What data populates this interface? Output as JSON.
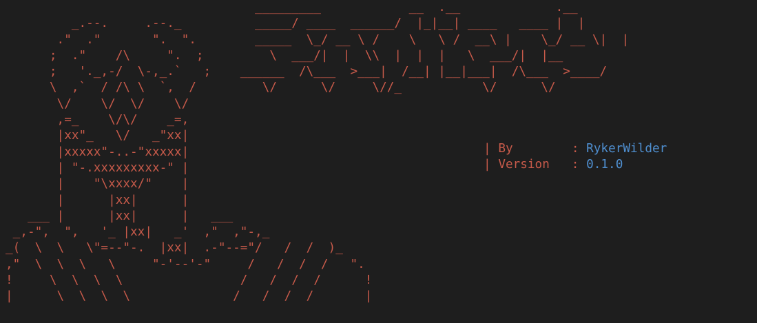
{
  "banner": {
    "art_lines": [
      "                                  _________            __  .__             .__",
      "         _.--.     .--._          _____/ ____  ______/  |_|__| ____   ____ |  |",
      "       .\"  .\"       \".  \".        _____  \\_/ __ \\ /    \\   \\ /  __\\ |    \\_/ __ \\|  |",
      "      ;  .\"    /\\     \".  ;         \\  ___/|  |  \\\\  |  |  |   \\  ___/|  |__",
      "      ;   '._,-/  \\-,_.`   ;    ______  /\\___  >___|  /__| |__|___|  /\\___  >____/",
      "      \\  ,`  / /\\ \\  `,  /         \\/      \\/     \\//_           \\/      \\/",
      "       \\/    \\/  \\/    \\/",
      "       ,=_    \\/\\/    _=,",
      "       |xx\"_   \\/   _\"xx|",
      "       |xxxxx\"-..-\"xxxxx|",
      "       | \"-.xxxxxxxxx-\" |",
      "       |    \"\\xxxx/\"    |",
      "       |      |xx|      |",
      "   ___ |      |xx|      |   ___",
      " _,-\",  \",   '_ |xx|   _'  ,\"  ,\"-,_",
      "_(  \\  \\   \\\"=--\"-.  |xx|  .-\"--=\"/   /  /  )_",
      ",\"  \\  \\  \\   \\     \"-'--'-\"     /   /  /  /   \".",
      "!     \\  \\  \\  \\                /   /  /  /      !",
      "|      \\  \\  \\  \\              /   /  /  /       |"
    ]
  },
  "info": {
    "by_label": "By",
    "by_value": "RykerWilder",
    "version_label": "Version",
    "version_value": "0.1.0"
  },
  "colors": {
    "background": "#1e1e1e",
    "art": "#c75a4a",
    "value": "#4f8fd0"
  }
}
